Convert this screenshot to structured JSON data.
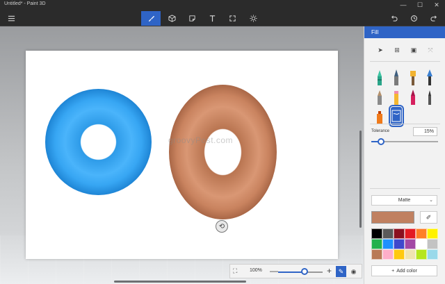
{
  "window": {
    "title": "Untitled* - Paint 3D",
    "minimize": "—",
    "maximize": "☐",
    "close": "✕"
  },
  "toolbar": {
    "menu_icon": "hamburger-menu-icon",
    "tools": [
      {
        "name": "brushes-icon",
        "active": true
      },
      {
        "name": "3d-shapes-icon",
        "active": false
      },
      {
        "name": "stickers-icon",
        "active": false
      },
      {
        "name": "text-icon",
        "active": false
      },
      {
        "name": "canvas-icon",
        "active": false
      },
      {
        "name": "effects-icon",
        "active": false
      }
    ],
    "right_icons": [
      "undo-icon",
      "history-icon",
      "redo-icon"
    ]
  },
  "canvas": {
    "watermark": "groovyPost.com"
  },
  "zoom": {
    "percent": "100%",
    "level": 0.6,
    "minus": "—",
    "plus": "+"
  },
  "panel": {
    "title": "Fill",
    "tolerance_label": "Tolerance",
    "tolerance_value": "15%",
    "tolerance_level": 0.15,
    "finish": "Matte",
    "current_color": "#c08060",
    "add_color_label": "Add color",
    "add_color_plus": "+",
    "palette": [
      "#000000",
      "#5a5a5a",
      "#8b1020",
      "#e31b23",
      "#ff7f27",
      "#fff200",
      "#22b14c",
      "#1e90ff",
      "#3f48cc",
      "#a349a4",
      "#ffffff",
      "#c3c3c3",
      "#b97a57",
      "#ffaec9",
      "#ffc90e",
      "#efe4b0",
      "#b5e61d",
      "#99d9ea"
    ]
  },
  "colors": {
    "accent": "#2f64c6",
    "donut_blue": "#37a6f3",
    "donut_brown": "#c9835f"
  }
}
